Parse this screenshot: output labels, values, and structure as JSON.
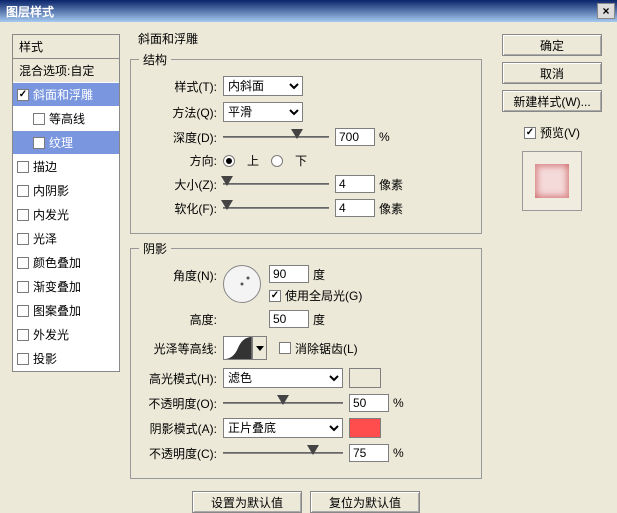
{
  "window": {
    "title": "图层样式"
  },
  "sidebar": {
    "header": "样式",
    "blend": "混合选项:自定",
    "items": [
      {
        "label": "斜面和浮雕",
        "checked": true,
        "selected": true
      },
      {
        "label": "等高线",
        "checked": false,
        "sub": true
      },
      {
        "label": "纹理",
        "checked": false,
        "sub": true,
        "selected": true
      },
      {
        "label": "描边",
        "checked": false
      },
      {
        "label": "内阴影",
        "checked": false
      },
      {
        "label": "内发光",
        "checked": false
      },
      {
        "label": "光泽",
        "checked": false
      },
      {
        "label": "颜色叠加",
        "checked": false
      },
      {
        "label": "渐变叠加",
        "checked": false
      },
      {
        "label": "图案叠加",
        "checked": false
      },
      {
        "label": "外发光",
        "checked": false
      },
      {
        "label": "投影",
        "checked": false
      }
    ]
  },
  "main": {
    "title": "斜面和浮雕",
    "structure": {
      "legend": "结构",
      "style_lbl": "样式(T):",
      "style_val": "内斜面",
      "method_lbl": "方法(Q):",
      "method_val": "平滑",
      "depth_lbl": "深度(D):",
      "depth_val": "700",
      "depth_unit": "%",
      "dir_lbl": "方向:",
      "dir_up": "上",
      "dir_down": "下",
      "size_lbl": "大小(Z):",
      "size_val": "4",
      "size_unit": "像素",
      "soften_lbl": "软化(F):",
      "soften_val": "4",
      "soften_unit": "像素"
    },
    "shadow": {
      "legend": "阴影",
      "angle_lbl": "角度(N):",
      "angle_val": "90",
      "angle_unit": "度",
      "global_lbl": "使用全局光(G)",
      "alt_lbl": "高度:",
      "alt_val": "50",
      "alt_unit": "度",
      "contour_lbl": "光泽等高线:",
      "antialias_lbl": "消除锯齿(L)",
      "hl_mode_lbl": "高光模式(H):",
      "hl_mode_val": "滤色",
      "hl_color": "#FFCCCC",
      "hl_op_lbl": "不透明度(O):",
      "hl_op_val": "50",
      "hl_op_unit": "%",
      "sh_mode_lbl": "阴影模式(A):",
      "sh_mode_val": "正片叠底",
      "sh_color": "#FF4D4D",
      "sh_op_lbl": "不透明度(C):",
      "sh_op_val": "75",
      "sh_op_unit": "%"
    },
    "buttons": {
      "default": "设置为默认值",
      "reset": "复位为默认值"
    }
  },
  "right": {
    "ok": "确定",
    "cancel": "取消",
    "newstyle": "新建样式(W)...",
    "preview_lbl": "预览(V)"
  }
}
